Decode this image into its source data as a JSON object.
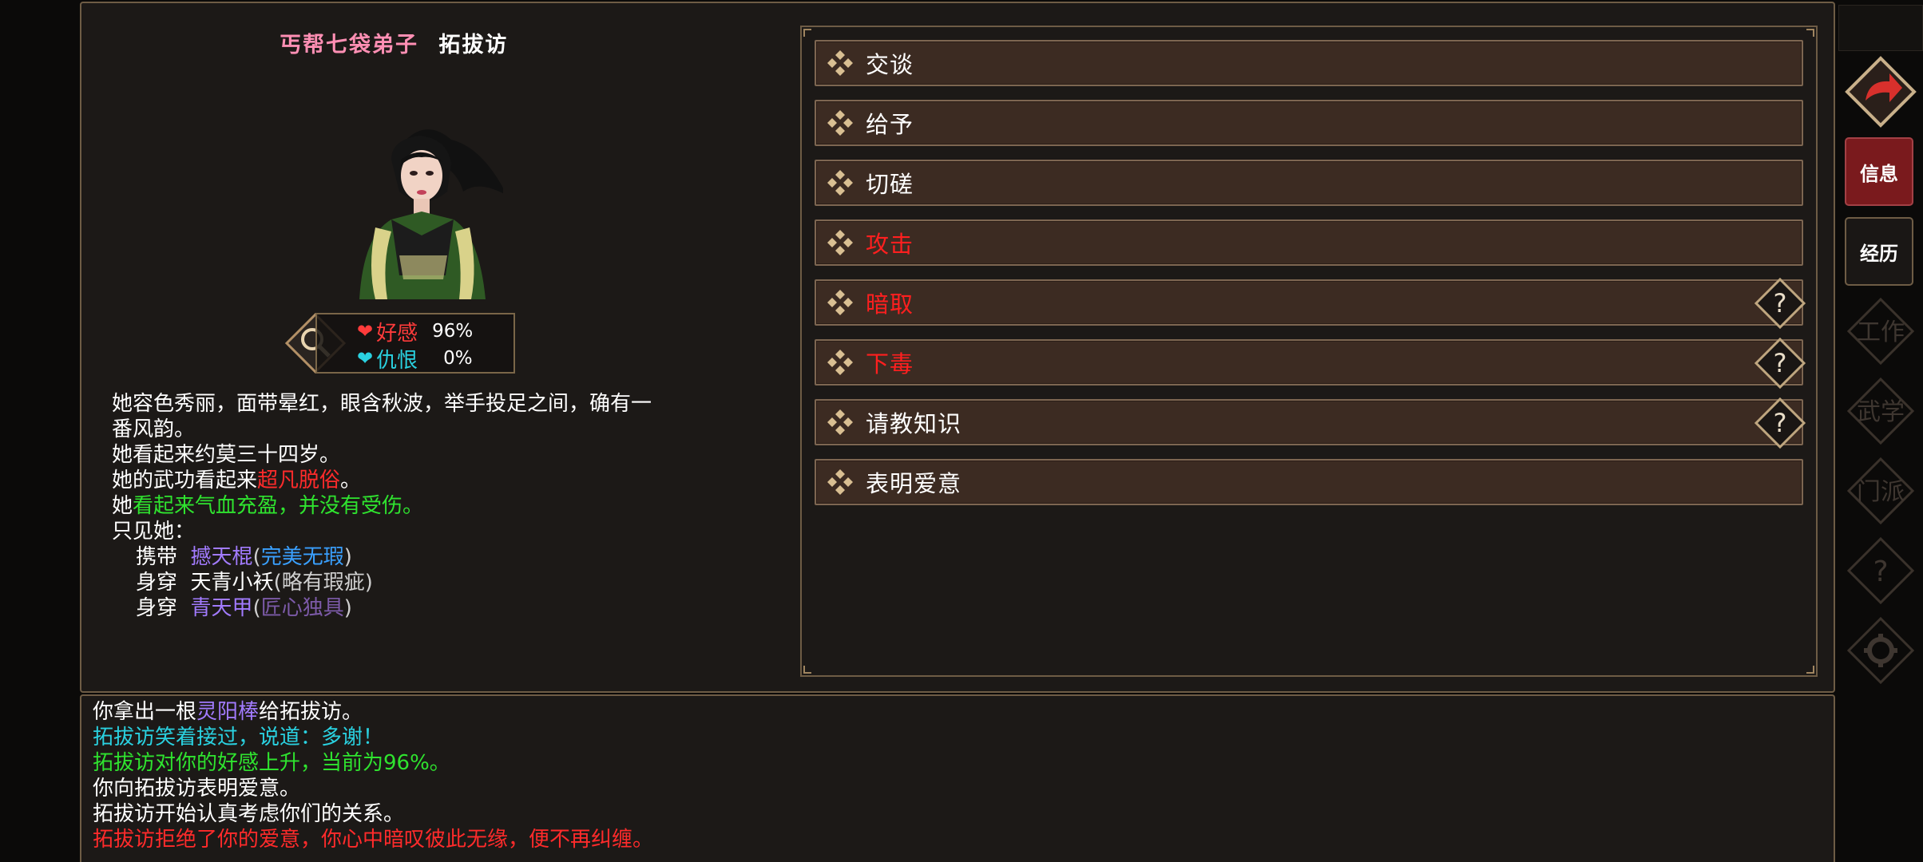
{
  "character": {
    "rank": "丐帮七袋弟子",
    "name": "拓拔访",
    "affection_label": "好感",
    "affection_value": "96%",
    "hatred_label": "仇恨",
    "hatred_value": "0%"
  },
  "description": {
    "line1": "她容色秀丽，面带晕红，眼含秋波，举手投足之间，确有一",
    "line2": "番风韵。",
    "age": "她看起来约莫三十四岁。",
    "martial_prefix": "她的武功看起来",
    "martial_level": "超凡脱俗",
    "martial_suffix": "。",
    "health_prefix": "她",
    "health_status": "看起来气血充盈，并没有受伤。",
    "observe": "只见她：",
    "equip": [
      {
        "verb": "携带",
        "item": "撼天棍",
        "open": "(",
        "quality": "完美无瑕",
        "close": ")"
      },
      {
        "verb": "身穿",
        "item": "天青小袄",
        "open": "(",
        "quality": "略有瑕疵",
        "close": ")"
      },
      {
        "verb": "身穿",
        "item": "青天甲",
        "open": "(",
        "quality": "匠心独具",
        "close": ")"
      }
    ]
  },
  "actions": [
    {
      "label": "交谈",
      "danger": false,
      "help": false
    },
    {
      "label": "给予",
      "danger": false,
      "help": false
    },
    {
      "label": "切磋",
      "danger": false,
      "help": false
    },
    {
      "label": "攻击",
      "danger": true,
      "help": false
    },
    {
      "label": "暗取",
      "danger": true,
      "help": true
    },
    {
      "label": "下毒",
      "danger": true,
      "help": true
    },
    {
      "label": "请教知识",
      "danger": false,
      "help": true
    },
    {
      "label": "表明爱意",
      "danger": false,
      "help": false
    }
  ],
  "sidebar": {
    "tab_info": "信息",
    "tab_history": "经历",
    "dim_items": [
      "工作",
      "武学",
      "门派",
      "?",
      "设置"
    ]
  },
  "log": {
    "l1_a": "你拿出一根",
    "l1_item": "灵阳棒",
    "l1_b": "给拓拔访。",
    "l2": "拓拔访笑着接过，说道：多谢！",
    "l3": "拓拔访对你的好感上升，当前为96%。",
    "l4": "你向拓拔访表明爱意。",
    "l5": "拓拔访开始认真考虑你们的关系。",
    "l6": "拓拔访拒绝了你的爱意，你心中暗叹彼此无缘，便不再纠缠。"
  },
  "colors": {
    "danger": "#ff1f1f",
    "affection_red": "#ff3b3b",
    "hatred_cyan": "#2ad1e0",
    "positive_green": "#2fe32f",
    "active_tab": "#7a1a1d"
  },
  "icons": {
    "action_bullet": "diamond-cluster-icon",
    "help": "question-diamond-icon",
    "back": "back-arrow-icon",
    "inspect": "magnifier-icon"
  }
}
